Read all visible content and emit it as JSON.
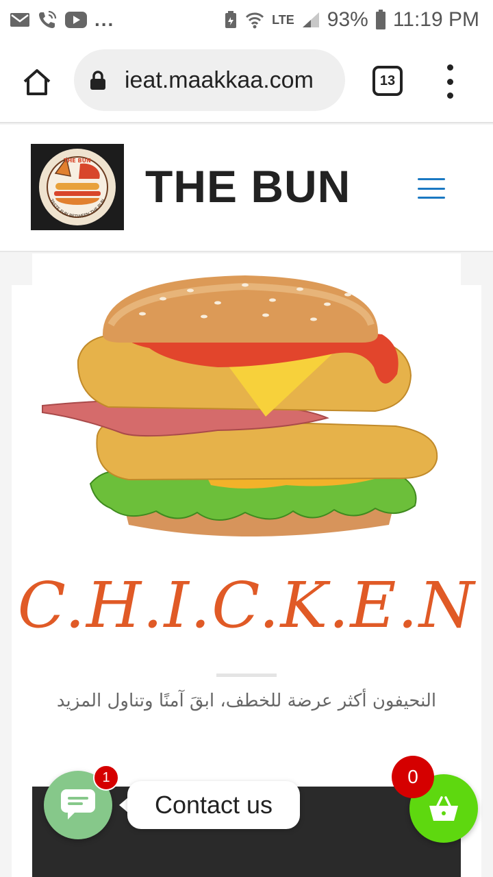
{
  "status_bar": {
    "overflow": "...",
    "network": "LTE",
    "battery": "93%",
    "time": "11:19 PM",
    "icons": [
      "mail-icon",
      "wifi-call-icon",
      "youtube-icon",
      "battery-saver-icon",
      "wifi-icon",
      "signal-icon",
      "battery-icon"
    ]
  },
  "browser": {
    "url": "ieat.maakkaa.com",
    "tab_count": "13",
    "icons": [
      "home-icon",
      "lock-icon",
      "menu-dots-icon"
    ]
  },
  "site": {
    "title": "THE BUN",
    "logo_text": "THE BUN",
    "logo_tagline": "TASTE FUN BETWEEN THE BUN",
    "menu_icon": "hamburger-icon"
  },
  "hero": {
    "image": "chicken-burger-image",
    "heading": "C.H.I.C.K.E.N",
    "tagline": "النحيفون أكثر عرضة للخطف، ابقَ آمنًا وتناول المزيد"
  },
  "floating": {
    "chat_badge": "1",
    "contact_label": "Contact us",
    "cart_count": "0",
    "accent_chat": "#86c88a",
    "accent_cart": "#5ed80f",
    "badge_color": "#d50000"
  },
  "colors": {
    "heading": "#e05a26",
    "menu": "#1a78c2"
  }
}
